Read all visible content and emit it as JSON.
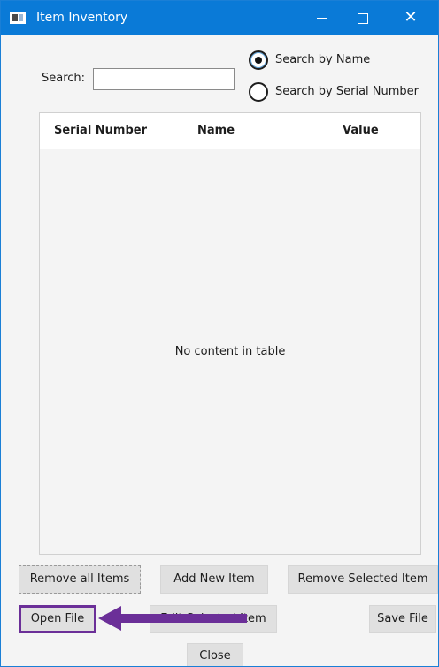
{
  "window": {
    "title": "Item Inventory",
    "minimize_glyph": "—",
    "close_glyph": "✕"
  },
  "search": {
    "label": "Search:",
    "value": "",
    "placeholder": ""
  },
  "search_mode": {
    "options": [
      {
        "label": "Search by Name",
        "selected": true
      },
      {
        "label": "Search by Serial Number",
        "selected": false
      }
    ]
  },
  "table": {
    "columns": [
      "Serial Number",
      "Name",
      "Value"
    ],
    "rows": [],
    "empty_message": "No content in table"
  },
  "buttons": {
    "remove_all": "Remove all Items",
    "add_new": "Add New Item",
    "remove_selected": "Remove Selected Item",
    "open_file": "Open File",
    "edit_selected": "Edit Selected Item",
    "save_file": "Save File",
    "close": "Close"
  },
  "colors": {
    "titlebar": "#0a7ad7",
    "highlight": "#6b2f98"
  }
}
